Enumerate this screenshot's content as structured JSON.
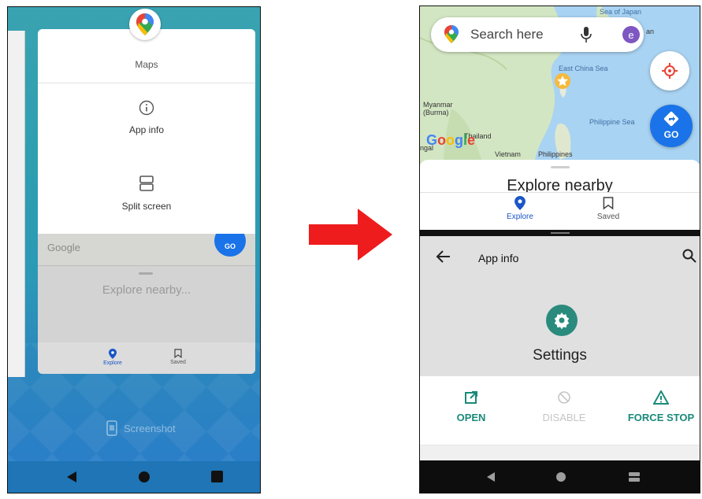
{
  "left_screen": {
    "popup": {
      "app_name": "Maps",
      "items": [
        {
          "label": "App info",
          "icon": "info-icon"
        },
        {
          "label": "Split screen",
          "icon": "split-screen-icon"
        }
      ]
    },
    "background_card": {
      "google_logo": "Google",
      "go_label": "GO",
      "explore_text": "Explore nearby...",
      "nav": [
        {
          "label": "Explore",
          "icon": "location-pin-icon"
        },
        {
          "label": "Saved",
          "icon": "bookmark-icon"
        }
      ]
    },
    "screenshot_label": "Screenshot",
    "system_nav": [
      "back-icon",
      "home-icon",
      "recents-icon"
    ]
  },
  "right_screen": {
    "maps": {
      "search_placeholder": "Search here",
      "avatar_letter": "e",
      "go_label": "GO",
      "google_logo": "Google",
      "map_labels": {
        "sea_of_japan": "Sea of Japan",
        "japan_fragment": "an",
        "east_china_sea": "East China Sea",
        "myanmar": "Myanmar\n(Burma)",
        "philippine_sea": "Philippine Sea",
        "thailand": "Thailand",
        "vietnam": "Vietnam",
        "philippines": "Philippines",
        "bengal_fragment": "ngal"
      },
      "explore_title": "Explore nearby",
      "nav": [
        {
          "label": "Explore",
          "icon": "location-pin-icon",
          "active": true
        },
        {
          "label": "Saved",
          "icon": "bookmark-icon",
          "active": false
        }
      ]
    },
    "app_info": {
      "title": "App info",
      "app_name": "Settings",
      "actions": [
        {
          "label": "OPEN",
          "icon": "open-external-icon",
          "enabled": true
        },
        {
          "label": "DISABLE",
          "icon": "disable-icon",
          "enabled": false
        },
        {
          "label": "FORCE STOP",
          "icon": "warning-icon",
          "enabled": true
        }
      ]
    },
    "system_nav": [
      "back-icon",
      "home-icon",
      "recents-icon"
    ]
  },
  "colors": {
    "accent_teal": "#1a8a7a",
    "maps_blue": "#1a73e8",
    "arrow_red": "#ee1c1c"
  }
}
